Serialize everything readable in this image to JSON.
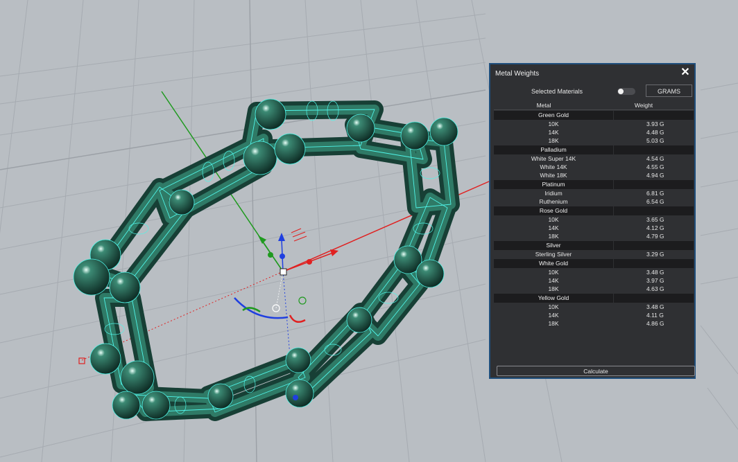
{
  "panel": {
    "title": "Metal Weights",
    "selected_materials_label": "Selected Materials",
    "selected_materials_toggle": false,
    "units_label": "GRAMS",
    "calculate_label": "Calculate",
    "columns": [
      "Metal",
      "Weight"
    ],
    "groups": [
      {
        "name": "Green Gold",
        "rows": [
          [
            "10K",
            "3.93 G"
          ],
          [
            "14K",
            "4.48 G"
          ],
          [
            "18K",
            "5.03 G"
          ]
        ]
      },
      {
        "name": "Palladium",
        "rows": [
          [
            "White Super 14K",
            "4.54 G"
          ],
          [
            "White 14K",
            "4.55 G"
          ],
          [
            "White 18K",
            "4.94 G"
          ]
        ]
      },
      {
        "name": "Platinum",
        "rows": [
          [
            "Iridium",
            "6.81 G"
          ],
          [
            "Ruthenium",
            "6.54 G"
          ]
        ]
      },
      {
        "name": "Rose Gold",
        "rows": [
          [
            "10K",
            "3.65 G"
          ],
          [
            "14K",
            "4.12 G"
          ],
          [
            "18K",
            "4.79 G"
          ]
        ]
      },
      {
        "name": "Silver",
        "rows": [
          [
            "Sterling Silver",
            "3.29 G"
          ]
        ]
      },
      {
        "name": "White Gold",
        "rows": [
          [
            "10K",
            "3.48 G"
          ],
          [
            "14K",
            "3.97 G"
          ],
          [
            "18K",
            "4.63 G"
          ]
        ]
      },
      {
        "name": "Yellow Gold",
        "rows": [
          [
            "10K",
            "3.48 G"
          ],
          [
            "14K",
            "4.11 G"
          ],
          [
            "18K",
            "4.86 G"
          ]
        ]
      }
    ]
  },
  "viewport": {
    "background": "#b9bec3",
    "grid_color": "#a5aab0",
    "model_color": "#1e5a4a",
    "wire_color": "#4ff5e8",
    "axis_x_color": "#e02020",
    "axis_y_color": "#1f9a1f",
    "axis_z_color": "#1f3fe0"
  }
}
